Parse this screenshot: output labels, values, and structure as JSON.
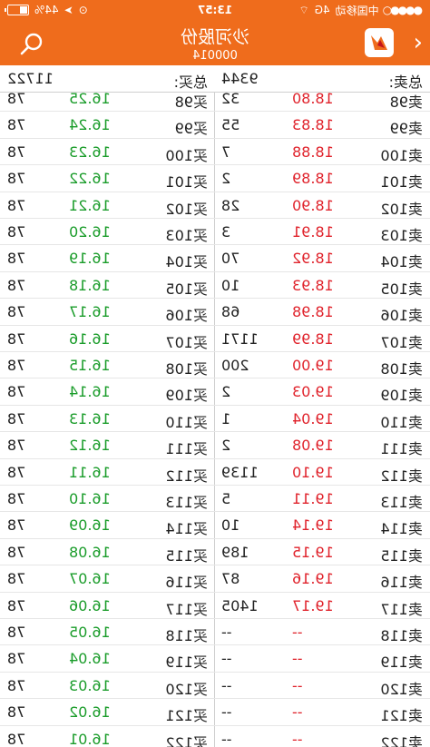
{
  "status": {
    "time": "13:57",
    "carrier": "中国移动",
    "network": "4G",
    "battery_pct": "44%",
    "battery_level": 0.44
  },
  "header": {
    "stock_name": "沙河股份",
    "stock_code": "000014",
    "back_glyph": "‹"
  },
  "totals": {
    "sell_label": "总卖:",
    "sell_value": "9344",
    "buy_label": "总买:",
    "buy_value": "11722"
  },
  "colors": {
    "accent": "#ef6c1c",
    "up": "#e0232c",
    "down": "#1a9c2a"
  },
  "rows": [
    {
      "sell_label": "卖98",
      "sell_price": "18.80",
      "sell_vol": "32",
      "buy_label": "买98",
      "buy_price": "16.25",
      "buy_vol": "78"
    },
    {
      "sell_label": "卖99",
      "sell_price": "18.83",
      "sell_vol": "55",
      "buy_label": "买99",
      "buy_price": "16.24",
      "buy_vol": "78"
    },
    {
      "sell_label": "卖100",
      "sell_price": "18.88",
      "sell_vol": "7",
      "buy_label": "买100",
      "buy_price": "16.23",
      "buy_vol": "78"
    },
    {
      "sell_label": "卖101",
      "sell_price": "18.89",
      "sell_vol": "2",
      "buy_label": "买101",
      "buy_price": "16.22",
      "buy_vol": "78"
    },
    {
      "sell_label": "卖102",
      "sell_price": "18.90",
      "sell_vol": "28",
      "buy_label": "买102",
      "buy_price": "16.21",
      "buy_vol": "78"
    },
    {
      "sell_label": "卖103",
      "sell_price": "18.91",
      "sell_vol": "3",
      "buy_label": "买103",
      "buy_price": "16.20",
      "buy_vol": "78"
    },
    {
      "sell_label": "卖104",
      "sell_price": "18.92",
      "sell_vol": "70",
      "buy_label": "买104",
      "buy_price": "16.19",
      "buy_vol": "78"
    },
    {
      "sell_label": "卖105",
      "sell_price": "18.93",
      "sell_vol": "10",
      "buy_label": "买105",
      "buy_price": "16.18",
      "buy_vol": "78"
    },
    {
      "sell_label": "卖106",
      "sell_price": "18.98",
      "sell_vol": "68",
      "buy_label": "买106",
      "buy_price": "16.17",
      "buy_vol": "78"
    },
    {
      "sell_label": "卖107",
      "sell_price": "18.99",
      "sell_vol": "1171",
      "buy_label": "买107",
      "buy_price": "16.16",
      "buy_vol": "78"
    },
    {
      "sell_label": "卖108",
      "sell_price": "19.00",
      "sell_vol": "200",
      "buy_label": "买108",
      "buy_price": "16.15",
      "buy_vol": "78"
    },
    {
      "sell_label": "卖109",
      "sell_price": "19.03",
      "sell_vol": "2",
      "buy_label": "买109",
      "buy_price": "16.14",
      "buy_vol": "78"
    },
    {
      "sell_label": "卖110",
      "sell_price": "19.04",
      "sell_vol": "1",
      "buy_label": "买110",
      "buy_price": "16.13",
      "buy_vol": "78"
    },
    {
      "sell_label": "卖111",
      "sell_price": "19.08",
      "sell_vol": "2",
      "buy_label": "买111",
      "buy_price": "16.12",
      "buy_vol": "78"
    },
    {
      "sell_label": "卖112",
      "sell_price": "19.10",
      "sell_vol": "1139",
      "buy_label": "买112",
      "buy_price": "16.11",
      "buy_vol": "78"
    },
    {
      "sell_label": "卖113",
      "sell_price": "19.11",
      "sell_vol": "5",
      "buy_label": "买113",
      "buy_price": "16.10",
      "buy_vol": "78"
    },
    {
      "sell_label": "卖114",
      "sell_price": "19.14",
      "sell_vol": "10",
      "buy_label": "买114",
      "buy_price": "16.09",
      "buy_vol": "78"
    },
    {
      "sell_label": "卖115",
      "sell_price": "19.15",
      "sell_vol": "189",
      "buy_label": "买115",
      "buy_price": "16.08",
      "buy_vol": "78"
    },
    {
      "sell_label": "卖116",
      "sell_price": "19.16",
      "sell_vol": "87",
      "buy_label": "买116",
      "buy_price": "16.07",
      "buy_vol": "78"
    },
    {
      "sell_label": "卖117",
      "sell_price": "19.17",
      "sell_vol": "1405",
      "buy_label": "买117",
      "buy_price": "16.06",
      "buy_vol": "78"
    },
    {
      "sell_label": "卖118",
      "sell_price": "--",
      "sell_vol": "--",
      "buy_label": "买118",
      "buy_price": "16.05",
      "buy_vol": "78"
    },
    {
      "sell_label": "卖119",
      "sell_price": "--",
      "sell_vol": "--",
      "buy_label": "买119",
      "buy_price": "16.04",
      "buy_vol": "78"
    },
    {
      "sell_label": "卖120",
      "sell_price": "--",
      "sell_vol": "--",
      "buy_label": "买120",
      "buy_price": "16.03",
      "buy_vol": "78"
    },
    {
      "sell_label": "卖121",
      "sell_price": "--",
      "sell_vol": "--",
      "buy_label": "买121",
      "buy_price": "16.02",
      "buy_vol": "78"
    },
    {
      "sell_label": "卖122",
      "sell_price": "--",
      "sell_vol": "--",
      "buy_label": "买122",
      "buy_price": "16.01",
      "buy_vol": "78"
    }
  ]
}
